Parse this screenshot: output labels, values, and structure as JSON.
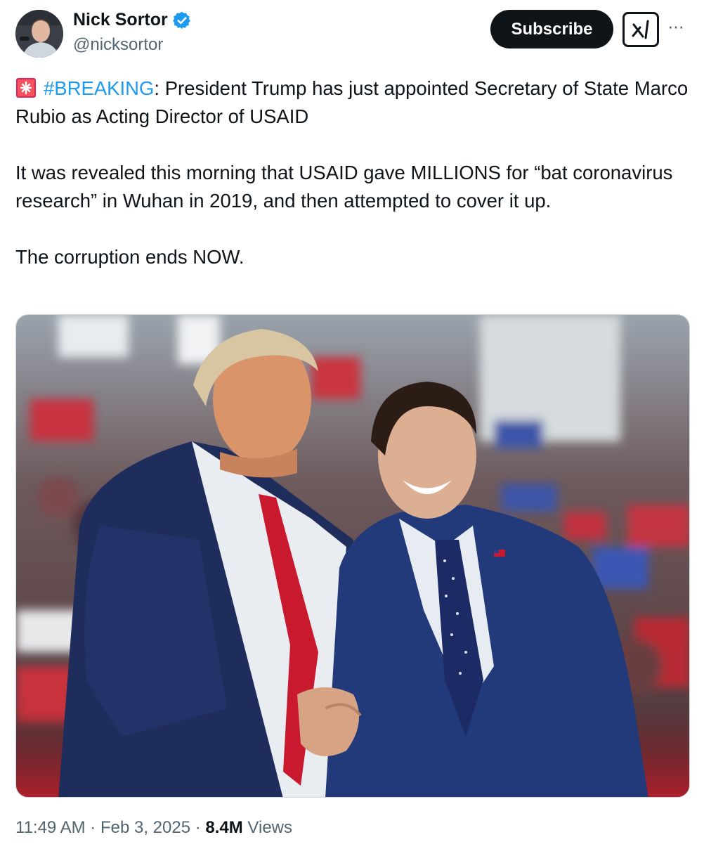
{
  "author": {
    "name": "Nick Sortor",
    "handle": "@nicksortor"
  },
  "actions": {
    "subscribe_label": "Subscribe",
    "more_label": "···"
  },
  "tweet": {
    "hashtag": "#BREAKING",
    "line1_rest": ": President Trump has just appointed Secretary of State Marco Rubio as Acting Director of USAID",
    "paragraph2": "It was revealed this morning that USAID gave MILLIONS for “bat coronavirus research” in Wuhan in 2019, and then attempted to cover it up.",
    "paragraph3": "The corruption ends NOW."
  },
  "meta": {
    "time": "11:49 AM",
    "sep1": " · ",
    "date": "Feb 3, 2025",
    "sep2": " · ",
    "views_count": "8.4M",
    "views_label": " Views"
  },
  "colors": {
    "link": "#1d9bf0",
    "text": "#0f1419",
    "secondary": "#536471",
    "verified": "#1d9bf0"
  },
  "icons": {
    "verified": "verified-badge-icon",
    "siren": "rotating-light-icon",
    "grok": "grok-icon"
  }
}
